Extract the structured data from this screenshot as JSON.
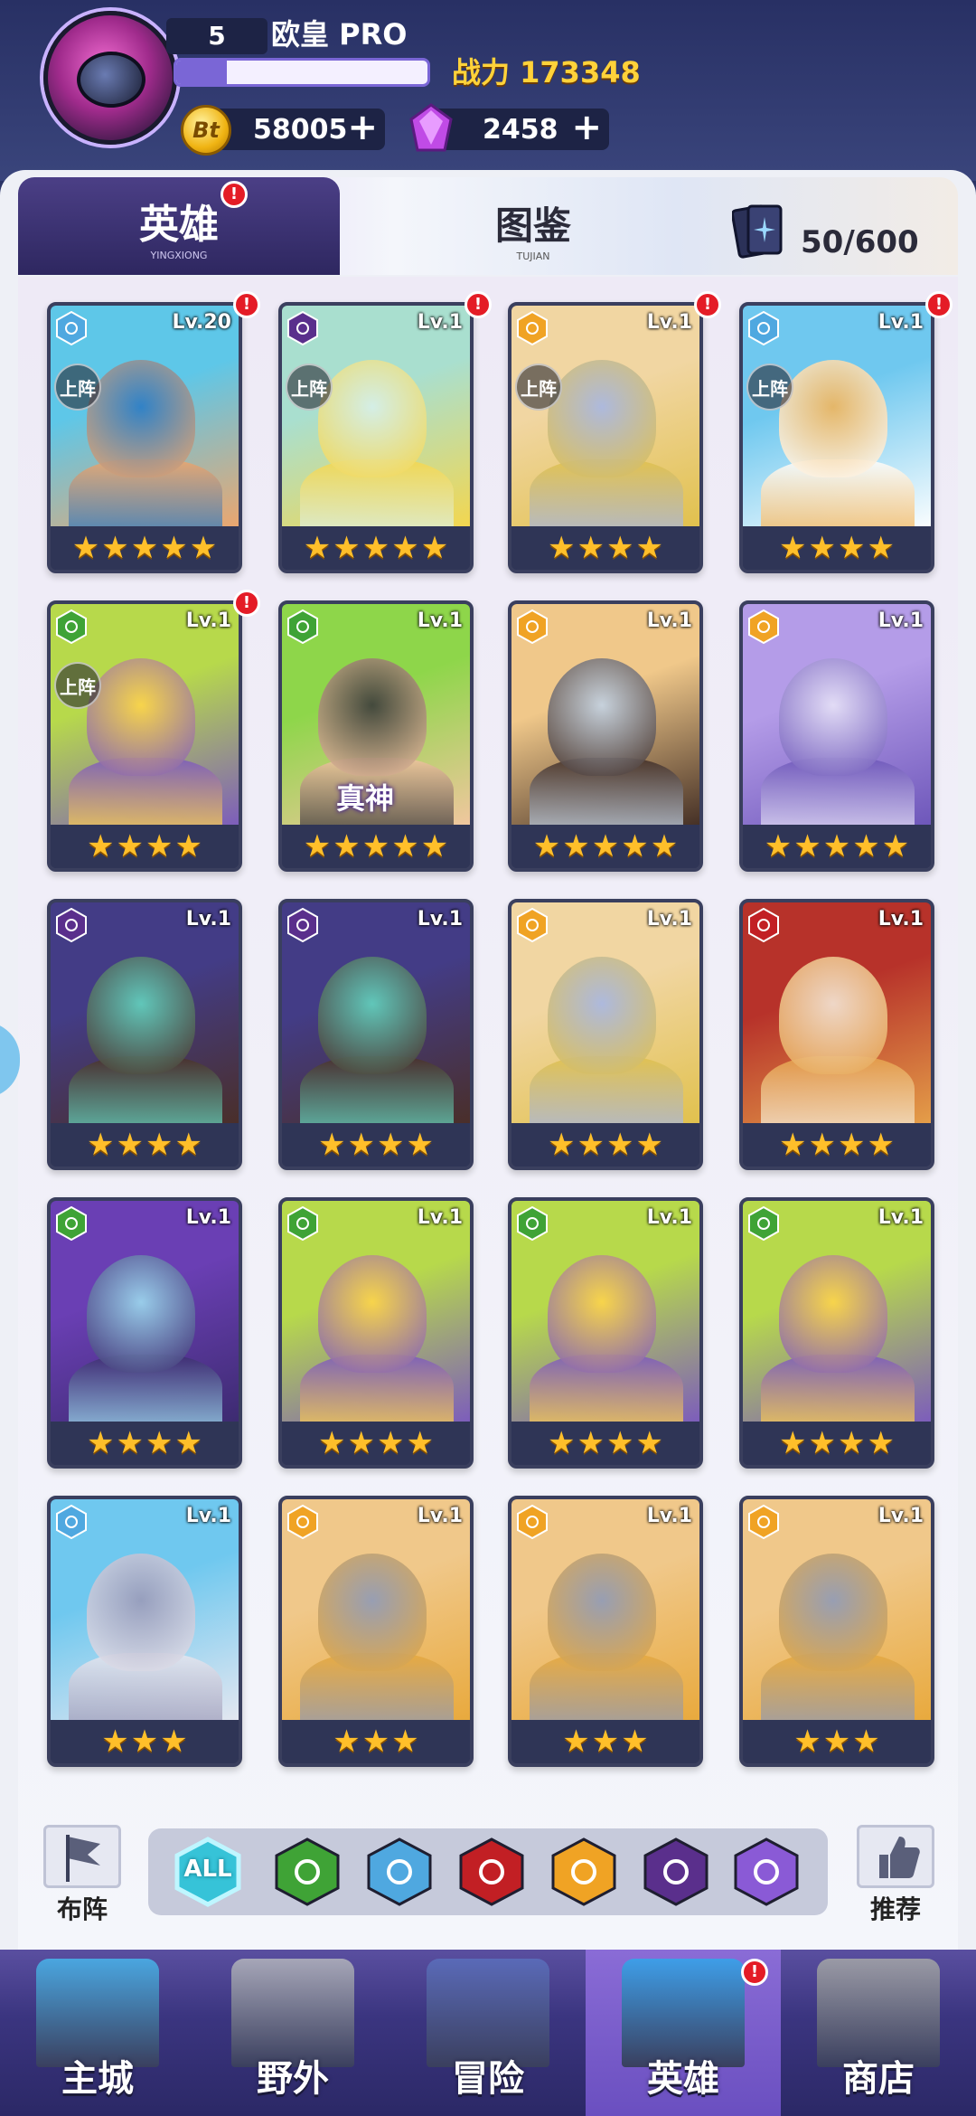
{
  "player": {
    "level": "5",
    "name": "欧皇 PRO",
    "exp_fraction": 0.2,
    "power_label": "战力 173348",
    "coins": "58005",
    "gems": "2458",
    "coin_glyph": "Bt",
    "plus": "+"
  },
  "tabs": {
    "hero": {
      "label": "英雄",
      "sub": "YINGXIONG",
      "badge": "!"
    },
    "book": {
      "label": "图鉴",
      "sub": "TUJIAN"
    },
    "card_count": "50/600"
  },
  "deploy_label": "上阵",
  "heroes": [
    {
      "level": "Lv.20",
      "element": "water",
      "stars": 5,
      "deployed": true,
      "badge": "!",
      "colors": [
        "#5ec7e8",
        "#2b7bc4",
        "#f0a56a"
      ]
    },
    {
      "level": "Lv.1",
      "element": "dark",
      "stars": 5,
      "deployed": true,
      "badge": "!",
      "colors": [
        "#a9dfcf",
        "#d8f0ea",
        "#f6d64a"
      ]
    },
    {
      "level": "Lv.1",
      "element": "light",
      "stars": 4,
      "deployed": true,
      "badge": "!",
      "colors": [
        "#f1d6a2",
        "#a6b6e4",
        "#e0c04a"
      ]
    },
    {
      "level": "Lv.1",
      "element": "water",
      "stars": 4,
      "deployed": true,
      "badge": "!",
      "colors": [
        "#6fc8ef",
        "#f0b45a",
        "#ffffff"
      ]
    },
    {
      "level": "Lv.1",
      "element": "wood",
      "stars": 4,
      "deployed": true,
      "badge": "!",
      "colors": [
        "#b7d94b",
        "#ffd54a",
        "#7a58c0"
      ]
    },
    {
      "level": "Lv.1",
      "element": "wood",
      "stars": 5,
      "deployed": false,
      "badge": "",
      "colors": [
        "#8ed64a",
        "#3a3a3a",
        "#f4c6a2"
      ],
      "overlay": "真神"
    },
    {
      "level": "Lv.1",
      "element": "light",
      "stars": 5,
      "deployed": false,
      "badge": "",
      "colors": [
        "#f0c88a",
        "#c4d4e6",
        "#3e2a22"
      ]
    },
    {
      "level": "Lv.1",
      "element": "light",
      "stars": 5,
      "deployed": false,
      "badge": "",
      "colors": [
        "#b49ce8",
        "#e8e4f8",
        "#6b54b8"
      ]
    },
    {
      "level": "Lv.1",
      "element": "dark",
      "stars": 4,
      "deployed": false,
      "badge": "",
      "colors": [
        "#433c86",
        "#64d6c0",
        "#4a2e26"
      ]
    },
    {
      "level": "Lv.1",
      "element": "dark",
      "stars": 4,
      "deployed": false,
      "badge": "",
      "colors": [
        "#433c86",
        "#64d6c0",
        "#4a2e26"
      ]
    },
    {
      "level": "Lv.1",
      "element": "light",
      "stars": 4,
      "deployed": false,
      "badge": "",
      "colors": [
        "#f1d6a2",
        "#a6b6e4",
        "#e0c04a"
      ]
    },
    {
      "level": "Lv.1",
      "element": "fire",
      "stars": 4,
      "deployed": false,
      "badge": "",
      "colors": [
        "#b7322a",
        "#f4e8d8",
        "#e6a24a"
      ]
    },
    {
      "level": "Lv.1",
      "element": "wood",
      "stars": 4,
      "deployed": false,
      "badge": "",
      "colors": [
        "#6a3fb4",
        "#9edcf0",
        "#3b2a6e"
      ]
    },
    {
      "level": "Lv.1",
      "element": "wood",
      "stars": 4,
      "deployed": false,
      "badge": "",
      "colors": [
        "#b7d94b",
        "#ffd54a",
        "#7a58c0"
      ]
    },
    {
      "level": "Lv.1",
      "element": "wood",
      "stars": 4,
      "deployed": false,
      "badge": "",
      "colors": [
        "#b7d94b",
        "#ffd54a",
        "#7a58c0"
      ]
    },
    {
      "level": "Lv.1",
      "element": "wood",
      "stars": 4,
      "deployed": false,
      "badge": "",
      "colors": [
        "#b7d94b",
        "#ffd54a",
        "#7a58c0"
      ]
    },
    {
      "level": "Lv.1",
      "element": "water",
      "stars": 3,
      "deployed": false,
      "badge": "",
      "colors": [
        "#6fc8ef",
        "#9a9ab8",
        "#e8e8f0"
      ]
    },
    {
      "level": "Lv.1",
      "element": "light",
      "stars": 3,
      "deployed": false,
      "badge": "",
      "colors": [
        "#f0c88a",
        "#8e9ab8",
        "#e8a83a"
      ]
    },
    {
      "level": "Lv.1",
      "element": "light",
      "stars": 3,
      "deployed": false,
      "badge": "",
      "colors": [
        "#f0c88a",
        "#8e9ab8",
        "#e8a83a"
      ]
    },
    {
      "level": "Lv.1",
      "element": "light",
      "stars": 3,
      "deployed": false,
      "badge": "",
      "colors": [
        "#f0c88a",
        "#8e9ab8",
        "#e8a83a"
      ]
    }
  ],
  "element_colors": {
    "water": "#4fa8e0",
    "dark": "#5a2f8c",
    "light": "#f0a324",
    "wood": "#3fa336",
    "fire": "#c21f24",
    "all": "#36c3d8",
    "arcane": "#8a5ad6"
  },
  "filters": [
    {
      "key": "all",
      "label": "ALL"
    },
    {
      "key": "wood",
      "label": ""
    },
    {
      "key": "water",
      "label": ""
    },
    {
      "key": "fire",
      "label": ""
    },
    {
      "key": "light",
      "label": ""
    },
    {
      "key": "dark",
      "label": ""
    },
    {
      "key": "arcane",
      "label": ""
    }
  ],
  "side_buttons": {
    "formation": "布阵",
    "recommend": "推荐"
  },
  "nav": [
    {
      "label": "主城",
      "color": "#4aa6e0"
    },
    {
      "label": "野外",
      "color": "#a6a6b8"
    },
    {
      "label": "冒险",
      "color": "#5a6ab8"
    },
    {
      "label": "英雄",
      "color": "#3e9ee8",
      "active": true,
      "badge": "!"
    },
    {
      "label": "商店",
      "color": "#9a9aa6"
    }
  ]
}
